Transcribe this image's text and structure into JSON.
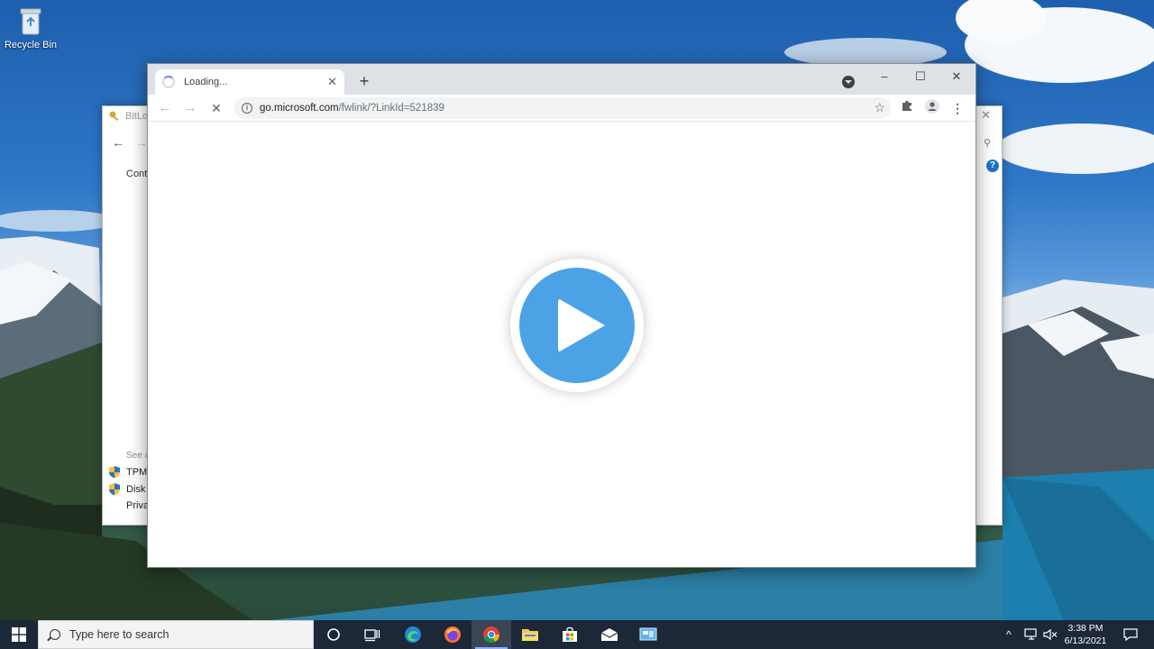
{
  "desktop": {
    "icons": [
      {
        "label": "Recycle Bin",
        "icon": "recycle-bin-icon"
      }
    ]
  },
  "control_panel": {
    "title": "BitLo",
    "home_link": "Cont",
    "see_also": "See a",
    "links": [
      {
        "label": "TPM",
        "icon": "uac-shield-icon"
      },
      {
        "label": "Disk",
        "icon": "uac-shield-icon"
      },
      {
        "label": "Priva"
      }
    ]
  },
  "browser": {
    "tabs": [
      {
        "title": "Loading...",
        "state": "loading"
      }
    ],
    "new_tab_label": "+",
    "address": {
      "host": "go.microsoft.com",
      "path": "/fwlink/?LinkId=521839"
    },
    "buttons": {
      "back": "←",
      "forward": "→",
      "stop": "✕",
      "star": "☆",
      "menu": "⋮",
      "minimize": "–",
      "maximize": "☐",
      "close": "✕"
    }
  },
  "overlay": {
    "icon": "play-button-icon",
    "color": "#4BA3E6"
  },
  "taskbar": {
    "search_placeholder": "Type here to search",
    "pinned": [
      {
        "name": "cortana",
        "icon": "cortana-circle-icon"
      },
      {
        "name": "task-view",
        "icon": "task-view-icon"
      },
      {
        "name": "edge",
        "icon": "edge-icon"
      },
      {
        "name": "firefox",
        "icon": "firefox-icon"
      },
      {
        "name": "chrome",
        "icon": "chrome-icon",
        "active": true
      },
      {
        "name": "file-explorer",
        "icon": "folder-icon"
      },
      {
        "name": "store",
        "icon": "store-icon"
      },
      {
        "name": "mail",
        "icon": "mail-icon"
      },
      {
        "name": "control-panel",
        "icon": "control-panel-icon"
      }
    ],
    "tray": {
      "chevron": "^"
    },
    "clock": {
      "time": "3:38 PM",
      "date": "6/13/2021"
    }
  }
}
